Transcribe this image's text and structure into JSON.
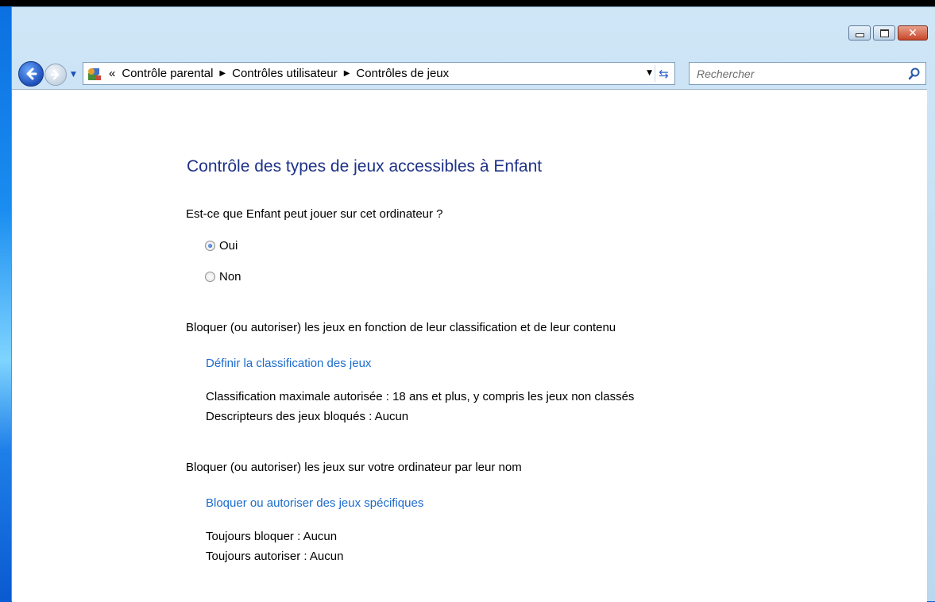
{
  "address_bar": {
    "prefix": "«",
    "crumbs": [
      "Contrôle parental",
      "Contrôles utilisateur",
      "Contrôles de jeux"
    ]
  },
  "search": {
    "placeholder": "Rechercher"
  },
  "main": {
    "title": "Contrôle des types de jeux accessibles à Enfant",
    "question": "Est-ce que Enfant peut jouer sur cet ordinateur ?",
    "options": [
      {
        "label": "Oui",
        "selected": true
      },
      {
        "label": "Non",
        "selected": false
      }
    ],
    "section_rating": {
      "heading": "Bloquer (ou autoriser) les jeux en fonction de leur classification et de leur contenu",
      "link": "Définir la classification des jeux",
      "max_rating": "Classification maximale autorisée :  18 ans et plus, y compris les jeux non classés",
      "blocked_descriptors": "Descripteurs des jeux bloqués :  Aucun"
    },
    "section_name": {
      "heading": "Bloquer (ou autoriser) les jeux sur votre ordinateur par leur nom",
      "link": "Bloquer ou autoriser des jeux spécifiques",
      "always_block": "Toujours bloquer :  Aucun",
      "always_allow": "Toujours autoriser :  Aucun"
    }
  },
  "colors": {
    "title": "#1e3287",
    "link": "#1c6bcc",
    "close_button": "#c7472a"
  },
  "icons": [
    "minimize-icon",
    "maximize-icon",
    "close-icon",
    "back-arrow-icon",
    "forward-arrow-icon",
    "control-panel-icon",
    "refresh-icon",
    "search-icon"
  ]
}
